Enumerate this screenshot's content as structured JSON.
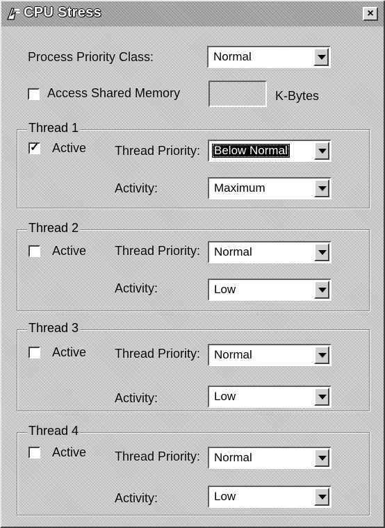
{
  "window": {
    "title": "CPU Stress",
    "close_label": "×"
  },
  "process": {
    "priority_label": "Process Priority Class:",
    "priority_value": "Normal",
    "shared_memory_label": "Access Shared Memory",
    "shared_memory_checked": false,
    "shared_memory_value": "",
    "kbytes_label": "K-Bytes"
  },
  "threads": [
    {
      "title": "Thread 1",
      "active_label": "Active",
      "active_check": "✓",
      "priority_label": "Thread Priority:",
      "priority_value": "Below Normal",
      "activity_label": "Activity:",
      "activity_value": "Maximum"
    },
    {
      "title": "Thread 2",
      "active_label": "Active",
      "active_check": "",
      "priority_label": "Thread Priority:",
      "priority_value": "Normal",
      "activity_label": "Activity:",
      "activity_value": "Low"
    },
    {
      "title": "Thread 3",
      "active_label": "Active",
      "active_check": "",
      "priority_label": "Thread Priority:",
      "priority_value": "Normal",
      "activity_label": "Activity:",
      "activity_value": "Low"
    },
    {
      "title": "Thread 4",
      "active_label": "Active",
      "active_check": "",
      "priority_label": "Thread Priority:",
      "priority_value": "Normal",
      "activity_label": "Activity:",
      "activity_value": "Low"
    }
  ]
}
